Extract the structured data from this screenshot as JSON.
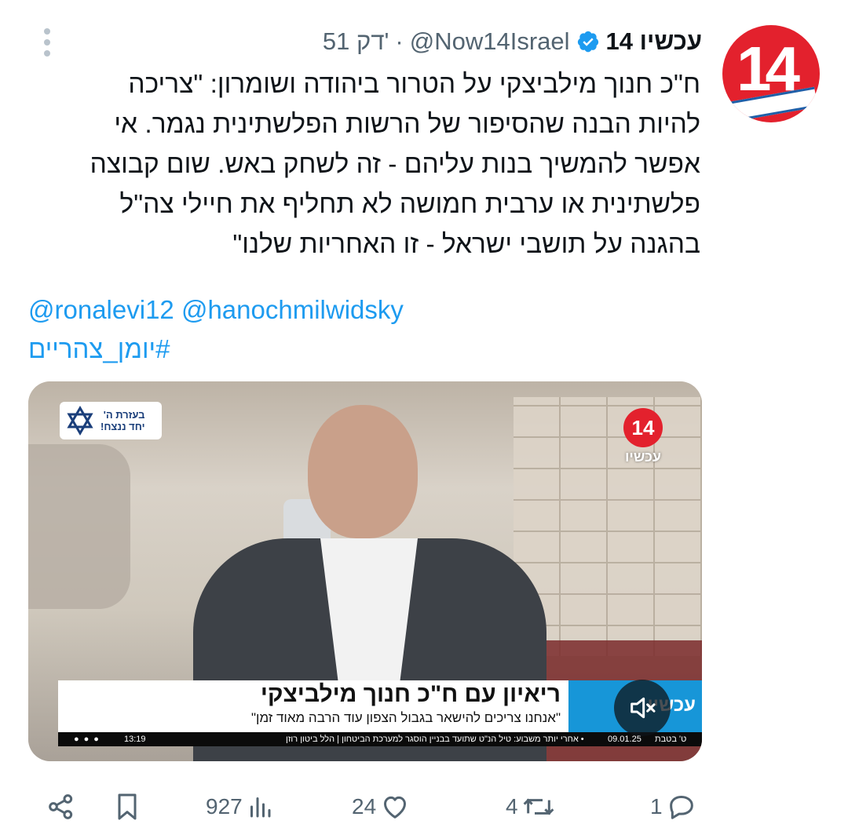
{
  "tweet": {
    "display_name": "עכשיו 14",
    "handle": "@Now14Israel",
    "separator": "·",
    "time": "51 דק'",
    "text_lines": [
      "ח\"כ חנוך מילביצקי על הטרור ביהודה ושומרון: \"צריכה",
      "להיות הבנה שהסיפור של הרשות הפלשתינית נגמר. אי",
      "אפשר להמשיך בנות עליהם - זה לשחק באש. שום קבוצה",
      "פלשתינית או ערבית חמושה לא תחליף את חיילי צה\"ל",
      "בהגנה על תושבי ישראל - זו האחריות שלנו\""
    ],
    "mentions": [
      "@ronalevi12",
      "@hanochmilwidsky"
    ],
    "hashtag": "#יומן_צהריים"
  },
  "avatar": {
    "number": "14"
  },
  "media": {
    "badge_text_line1": "בעזרת ה'",
    "badge_text_line2": "יחד ננצח!",
    "logo_number": "14",
    "logo_label": "עכשיו",
    "lower_third_title": "ריאיון עם ח\"כ חנוך מילביצקי",
    "lower_third_subtitle": "\"אנחנו צריכים להישאר בגבול הצפון עוד הרבה מאוד זמן\"",
    "lower_third_blue_text": "עכשיו",
    "ticker_clock": "13:19",
    "ticker_text": "• אחרי יותר משבוע: טיל הנ\"ט שתועד בבניין הוסגר למערכת הביטחון | הלל ביטון רוזן",
    "ticker_date": "09.01.25",
    "ticker_day": "ט' בטבת",
    "mute_icon": "speaker-muted-icon"
  },
  "actions": {
    "reply_count": "1",
    "retweet_count": "4",
    "like_count": "24",
    "views_count": "927"
  },
  "colors": {
    "link": "#1d9bf0",
    "secondary_text": "#536471",
    "brand_red": "#e3212d",
    "verified_blue": "#1d9bf0"
  }
}
